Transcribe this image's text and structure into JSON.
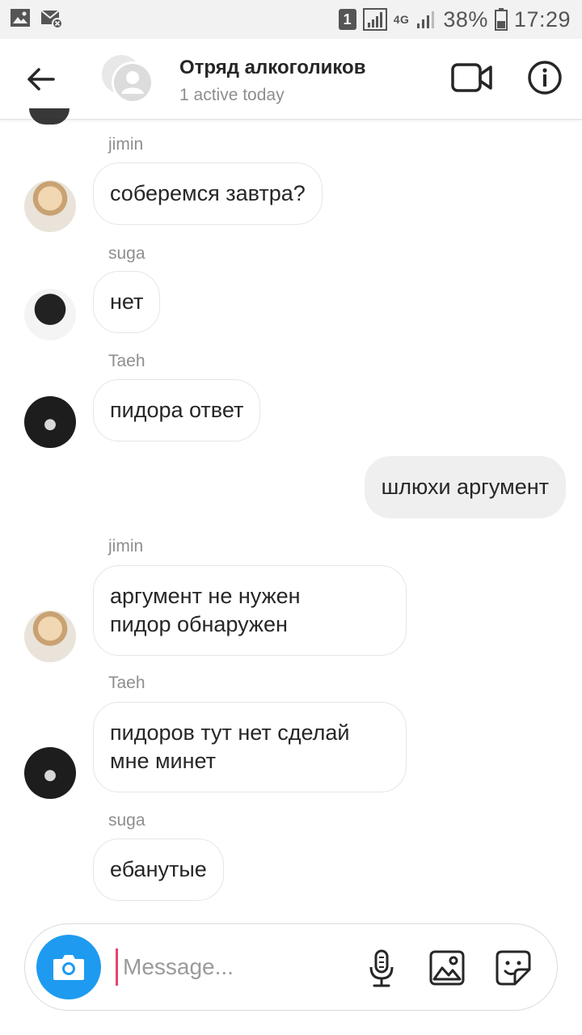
{
  "status_bar": {
    "sim": "1",
    "network": "4G",
    "battery": "38%",
    "time": "17:29"
  },
  "header": {
    "title": "Отряд алкоголиков",
    "subtitle": "1 active today"
  },
  "messages": [
    {
      "sender": "jimin",
      "text": "соберемся завтра?"
    },
    {
      "sender": "suga",
      "text": "нет"
    },
    {
      "sender": "Taeh",
      "text": "пидора ответ"
    },
    {
      "sender": "",
      "text": "шлюхи аргумент"
    },
    {
      "sender": "jimin",
      "text": "аргумент не нужен\nпидор обнаружен"
    },
    {
      "sender": "Taeh",
      "text": "пидоров тут нет сделай\nмне минет"
    },
    {
      "sender": "suga",
      "text": "ебанутые"
    }
  ],
  "composer": {
    "placeholder": "Message..."
  },
  "icons": {
    "back": "arrow-left-icon",
    "video": "video-camera-icon",
    "info": "info-icon",
    "camera": "camera-icon",
    "mic": "microphone-icon",
    "gallery": "image-icon",
    "sticker": "sticker-icon"
  },
  "colors": {
    "accent": "#1e9bf0",
    "cursor": "#e3466e",
    "own_bubble": "#efefef",
    "secondary_text": "#8e8e8e"
  }
}
